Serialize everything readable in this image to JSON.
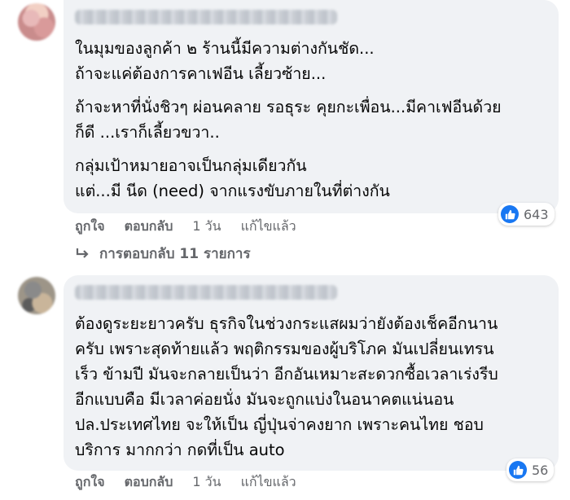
{
  "comments": [
    {
      "paragraphs": [
        [
          "ในมุมของลูกค้า ๒ ร้านนี้มีความต่างกันชัด...",
          "ถ้าจะแค่ต้องการคาเฟอีน เลี้ยวซ้าย..."
        ],
        [
          "ถ้าจะหาที่นั่งชิวๆ ผ่อนคลาย รอธุระ คุยกะเพื่อน...มีคาเฟอีนด้วย",
          "ก็ดี ...เราก็เลี้ยวขวา.."
        ],
        [
          "กลุ่มเป้าหมายอาจเป็นกลุ่มเดียวกัน",
          "แต่...มี นีด (need) จากแรงขับภายในที่ต่างกัน"
        ]
      ],
      "like_label": "ถูกใจ",
      "reply_label": "ตอบกลับ",
      "time": "1 วัน",
      "edited_label": "แก้ไขแล้ว",
      "reaction_count": "643",
      "replies_link": "การตอบกลับ 11 รายการ"
    },
    {
      "lines": [
        "ต้องดูระยะยาวครับ ธุรกิจในช่วงกระแสผมว่ายังต้องเช็คอีกนาน",
        "ครับ เพราะสุดท้ายแล้ว พฤติกรรมของผู้บริโภค มันเปลี่ยนเทรน",
        "เร็ว ข้ามปี มันจะกลายเป็นว่า อีกอันเหมาะสะดวกซื้อเวลาเร่งรีบ",
        "อีกแบบคือ มีเวลาค่อยนั่ง มันจะถูกแบ่งในอนาคตแน่นอน",
        "ปล.ประเทศไทย จะให้เป็น ญี่ปุ่นจ่าคงยาก เพราะคนไทย ชอบ",
        "บริการ มากกว่า กดที่เป็น auto"
      ],
      "like_label": "ถูกใจ",
      "reply_label": "ตอบกลับ",
      "time": "1 วัน",
      "edited_label": "แก้ไขแล้ว",
      "reaction_count": "56"
    }
  ],
  "colors": {
    "like_blue": "#1877f2",
    "bubble_bg": "#f0f2f5",
    "meta_gray": "#65676b"
  },
  "icons": {
    "reaction": "thumbs-up-icon",
    "reply_arrow": "reply-arrow-icon"
  }
}
